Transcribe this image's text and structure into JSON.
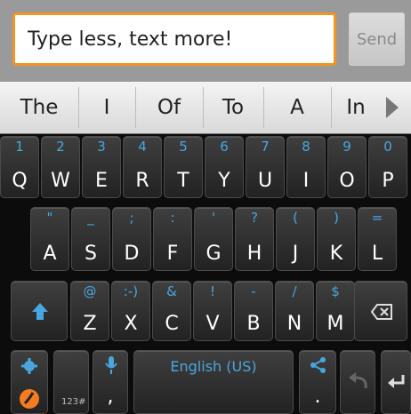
{
  "composer": {
    "placeholder": "Type less, text more!",
    "send_label": "Send"
  },
  "suggestions": [
    "The",
    "I",
    "Of",
    "To",
    "A",
    "In"
  ],
  "keyboard": {
    "rows": [
      [
        {
          "hint": "1",
          "main": "Q"
        },
        {
          "hint": "2",
          "main": "W"
        },
        {
          "hint": "3",
          "main": "E"
        },
        {
          "hint": "4",
          "main": "R"
        },
        {
          "hint": "5",
          "main": "T"
        },
        {
          "hint": "6",
          "main": "Y"
        },
        {
          "hint": "7",
          "main": "U"
        },
        {
          "hint": "8",
          "main": "I"
        },
        {
          "hint": "9",
          "main": "O"
        },
        {
          "hint": "0",
          "main": "P"
        }
      ],
      [
        {
          "hint": "\"",
          "main": "A"
        },
        {
          "hint": "_",
          "main": "S"
        },
        {
          "hint": ";",
          "main": "D"
        },
        {
          "hint": ":",
          "main": "F"
        },
        {
          "hint": "'",
          "main": "G"
        },
        {
          "hint": "?",
          "main": "H"
        },
        {
          "hint": "(",
          "main": "J"
        },
        {
          "hint": ")",
          "main": "K"
        },
        {
          "hint": "=",
          "main": "L"
        }
      ],
      [
        {
          "hint": "@",
          "main": "Z"
        },
        {
          "hint": ":-)",
          "main": "X"
        },
        {
          "hint": "&",
          "main": "C"
        },
        {
          "hint": "!",
          "main": "V"
        },
        {
          "hint": "-",
          "main": "B"
        },
        {
          "hint": "/",
          "main": "N"
        },
        {
          "hint": "$",
          "main": "M"
        }
      ]
    ],
    "space_label": "English (US)",
    "numbers_label": "123#",
    "period_label": ".",
    "comma_label": ",",
    "accent_color": "#49a7e0",
    "icons": [
      "shift-icon",
      "backspace-icon",
      "settings-gear-icon",
      "swype-logo-icon",
      "mic-icon",
      "share-icon",
      "undo-icon",
      "enter-icon"
    ]
  }
}
